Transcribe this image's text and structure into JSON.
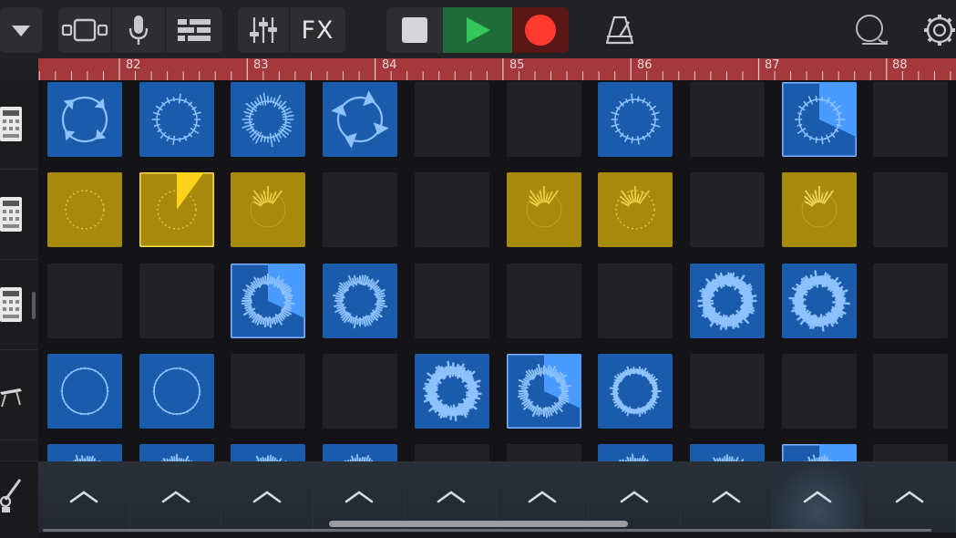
{
  "toolbar": {
    "fx_label": "FX",
    "left_items": [
      "browser-dropdown-icon",
      "view-switcher-icon",
      "microphone-icon",
      "tracks-view-icon",
      "mixer-sliders-icon"
    ],
    "transport": [
      "stop-icon",
      "play-icon",
      "record-icon"
    ],
    "right_items": [
      "metronome-icon",
      "loop-browser-icon",
      "settings-icon"
    ],
    "colors": {
      "play_bg": "#1f6b3a",
      "play_icon": "#35c759",
      "record_bg": "#5a1616",
      "record_icon": "#ff3b30",
      "stop_bg": "#2e2e31"
    }
  },
  "ruler": {
    "bars": [
      "82",
      "83",
      "84",
      "85",
      "86",
      "87",
      "88"
    ],
    "color": "#a4383c"
  },
  "tracks": [
    {
      "icon": "drum-machine-icon"
    },
    {
      "icon": "drum-machine-icon"
    },
    {
      "icon": "drum-machine-icon"
    },
    {
      "icon": "keyboard-icon"
    },
    {
      "icon": "guitar-icon"
    }
  ],
  "grid": {
    "columns": 10,
    "rows": [
      [
        "blue:loop-arrows",
        "blue:spiky",
        "blue:spiky-dense",
        "blue:cycle-arrows",
        "empty",
        "empty",
        "blue:spiky",
        "empty",
        "blue-active:spiky-playing",
        "empty"
      ],
      [
        "yellow:dotted",
        "yellow-active:dotted-playing",
        "yellow:burst",
        "empty",
        "empty",
        "yellow:burst",
        "yellow:burst-dotted",
        "empty",
        "yellow:burst-small",
        "empty"
      ],
      [
        "empty",
        "empty",
        "blue-active:wave-playing",
        "blue:wave",
        "empty",
        "empty",
        "empty",
        "blue:wave-heavy",
        "blue:wave-heavy",
        "empty"
      ],
      [
        "blue:thin-circle",
        "blue:thin-circle",
        "empty",
        "empty",
        "blue:wave-heavy",
        "blue-active:wave-playing",
        "blue:wave-ring",
        "empty",
        "empty",
        "empty"
      ],
      [
        "blue:wave",
        "blue:wave",
        "blue:wave",
        "blue:wave",
        "empty",
        "empty",
        "blue:wave",
        "blue:wave",
        "blue-active:wave-playing",
        "empty"
      ]
    ]
  },
  "triggers": {
    "count": 10,
    "icon": "chevron-up-icon"
  },
  "colors": {
    "clip_blue": "#1a5bab",
    "clip_blue_highlight": "#4a9bff",
    "clip_yellow": "#a78a0c",
    "clip_yellow_highlight": "#ffd21a",
    "empty_cell": "#222225"
  }
}
